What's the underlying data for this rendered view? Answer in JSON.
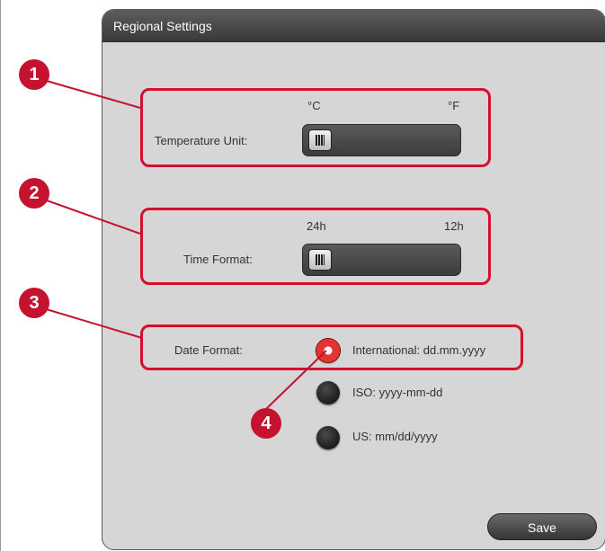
{
  "window": {
    "title": "Regional Settings"
  },
  "temperature": {
    "label": "Temperature Unit:",
    "option_left": "°C",
    "option_right": "°F",
    "selected": "°C"
  },
  "time": {
    "label": "Time Format:",
    "option_left": "24h",
    "option_right": "12h",
    "selected": "24h"
  },
  "date": {
    "label": "Date Format:",
    "options": [
      {
        "label": "International: dd.mm.yyyy",
        "selected": true
      },
      {
        "label": "ISO: yyyy-mm-dd",
        "selected": false
      },
      {
        "label": "US: mm/dd/yyyy",
        "selected": false
      }
    ]
  },
  "actions": {
    "save_label": "Save"
  },
  "callouts": [
    "1",
    "2",
    "3",
    "4"
  ],
  "colors": {
    "callout": "#c4122f",
    "highlight": "#d70f2f",
    "radio_selected": "#e23430"
  }
}
